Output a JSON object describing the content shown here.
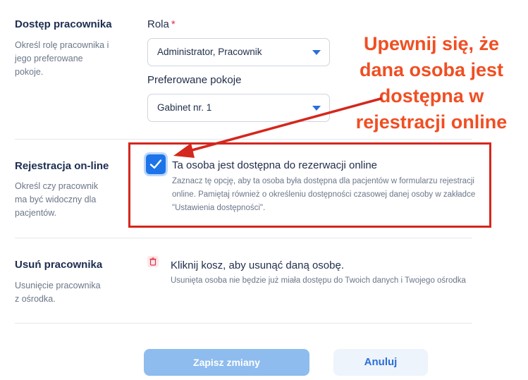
{
  "access": {
    "title": "Dostęp pracownika",
    "description": "Określ rolę pracownika i jego preferowane pokoje.",
    "role_label": "Rola",
    "required_mark": "*",
    "role_value": "Administrator, Pracownik",
    "rooms_label": "Preferowane pokoje",
    "rooms_value": "Gabinet nr. 1"
  },
  "annotation": {
    "callout": "Upewnij się, że dana osoba jest dostępna w rejestracji online",
    "accent_color": "#f04e23",
    "box_color": "#d4271d"
  },
  "online": {
    "title": "Rejestracja on-line",
    "description": "Określ czy pracownik ma być widoczny dla pacjentów.",
    "checkbox_checked": true,
    "option_title": "Ta osoba jest dostępna do rezerwacji online",
    "option_description": "Zaznacz tę opcję, aby ta osoba była dostępna dla pacjentów w formularzu rejestracji online. Pamiętaj również o określeniu dostępności czasowej danej osoby w zakładce \"Ustawienia dostępności\"."
  },
  "remove": {
    "title": "Usuń pracownika",
    "description": "Usunięcie pracownika z ośrodka.",
    "action_title": "Kliknij kosz, aby usunąć daną osobę.",
    "action_description": "Usunięta osoba nie będzie już miała dostępu do Twoich danych i Twojego ośrodka"
  },
  "footer": {
    "save_label": "Zapisz zmiany",
    "cancel_label": "Anuluj"
  },
  "icons": {
    "caret": "chevron-down-icon",
    "check": "check-icon",
    "trash": "trash-icon"
  },
  "colors": {
    "primary": "#1d74e8",
    "save_disabled": "#8ebcee",
    "text_muted": "#6b7689"
  }
}
